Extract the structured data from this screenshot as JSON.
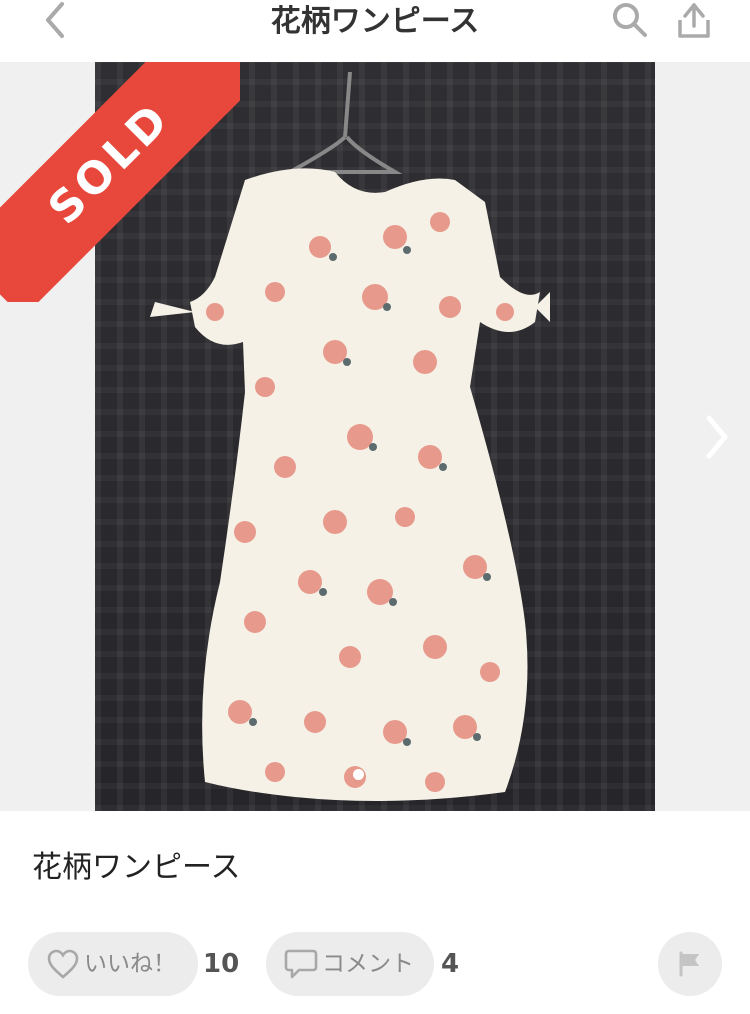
{
  "header": {
    "title": "花柄ワンピース",
    "back_icon": "chevron-left-icon",
    "search_icon": "search-icon",
    "share_icon": "share-icon"
  },
  "gallery": {
    "badge": "SOLD",
    "badge_color": "#e8473c",
    "page_count": 1,
    "current_page": 1,
    "next_icon": "chevron-right-icon"
  },
  "item": {
    "name": "花柄ワンピース"
  },
  "actions": {
    "like_label": "いいね！",
    "like_count": "10",
    "comment_label": "コメント",
    "comment_count": "4",
    "like_icon": "heart-icon",
    "comment_icon": "speech-bubble-icon",
    "report_icon": "flag-icon"
  }
}
